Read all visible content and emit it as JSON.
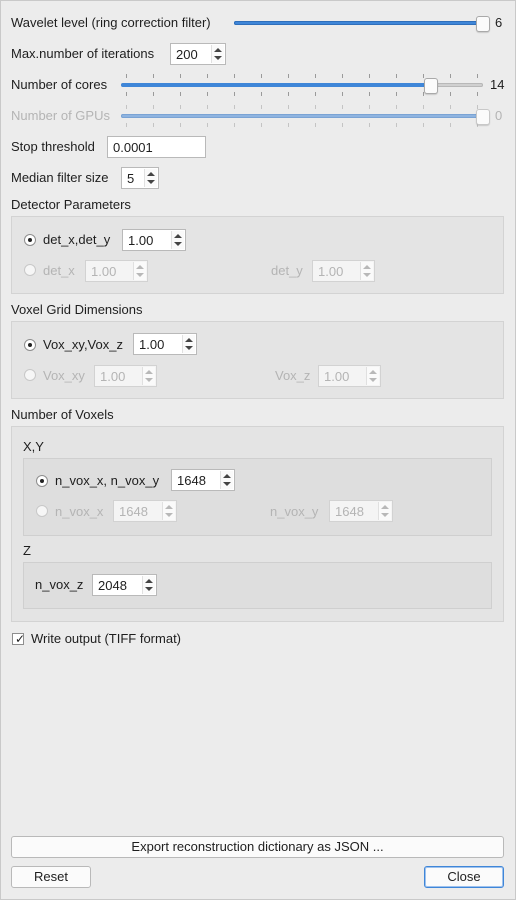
{
  "wavelet": {
    "label": "Wavelet level (ring correction filter)",
    "value": "6"
  },
  "iterations": {
    "label": "Max.number of iterations",
    "value": "200"
  },
  "cores": {
    "label": "Number of cores",
    "value": "14"
  },
  "gpus": {
    "label": "Number of GPUs",
    "value": "0"
  },
  "stop_threshold": {
    "label": "Stop threshold",
    "value": "0.0001"
  },
  "median_filter": {
    "label": "Median filter size",
    "value": "5"
  },
  "detector": {
    "title": "Detector Parameters",
    "combined_label": "det_x,det_y",
    "combined_value": "1.00",
    "x_label": "det_x",
    "x_value": "1.00",
    "y_label": "det_y",
    "y_value": "1.00"
  },
  "voxel_grid": {
    "title": "Voxel Grid Dimensions",
    "combined_label": "Vox_xy,Vox_z",
    "combined_value": "1.00",
    "xy_label": "Vox_xy",
    "xy_value": "1.00",
    "z_label": "Vox_z",
    "z_value": "1.00"
  },
  "num_voxels": {
    "title": "Number of Voxels",
    "xy_title": "X,Y",
    "combined_label": "n_vox_x, n_vox_y",
    "combined_value": "1648",
    "x_label": "n_vox_x",
    "x_value": "1648",
    "y_label": "n_vox_y",
    "y_value": "1648",
    "z_title": "Z",
    "z_label": "n_vox_z",
    "z_value": "2048"
  },
  "write_output": {
    "label": "Write output (TIFF format)",
    "checked": true
  },
  "buttons": {
    "export": "Export reconstruction dictionary as JSON ...",
    "reset": "Reset",
    "close": "Close"
  },
  "colors": {
    "accent": "#3f86d8",
    "background": "#ececec",
    "disabled_text": "#b4b4b4"
  }
}
